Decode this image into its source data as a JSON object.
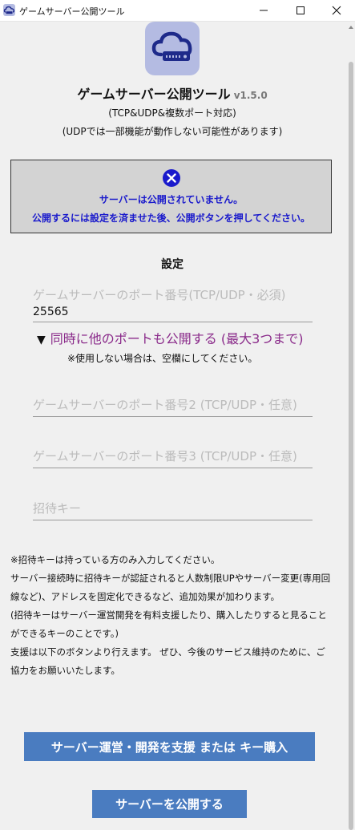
{
  "window": {
    "title": "ゲームサーバー公開ツール"
  },
  "app": {
    "name": "ゲームサーバー公開ツール",
    "version": "v1.5.0",
    "subtitle1": "(TCP&UDP&複数ポート対応)",
    "subtitle2": "(UDPでは一部機能が動作しない可能性があります)"
  },
  "status": {
    "line1": "サーバーは公開されていません。",
    "line2": "公開するには設定を済ませた後、公開ボタンを押してください。",
    "color": "#1a1acc"
  },
  "settings": {
    "heading": "設定",
    "port1": {
      "label": "ゲームサーバーのポート番号(TCP/UDP・必須)",
      "value": "25565"
    },
    "expander": {
      "arrow": "▼",
      "label": "同時に他のポートも公開する (最大3つまで)"
    },
    "note": "※使用しない場合は、空欄にしてください。",
    "port2": {
      "placeholder": "ゲームサーバーのポート番号2 (TCP/UDP・任意)"
    },
    "port3": {
      "placeholder": "ゲームサーバーのポート番号3 (TCP/UDP・任意)"
    },
    "invite": {
      "placeholder": "招待キー"
    }
  },
  "info": [
    "※招待キーは持っている方のみ入力してください。",
    "サーバー接続時に招待キーが認証されると人数制限UPやサーバー変更(専用回線など)、アドレスを固定化できるなど、追加効果が加わります。",
    "(招待キーはサーバー運営開発を有料支援したり、購入したりすると見ることができるキーのことです。)",
    "支援は以下のボタンより行えます。 ぜひ、今後のサービス維持のために、ご協力をお願いいたします。"
  ],
  "buttons": {
    "support": "サーバー運営・開発を支援 または キー購入",
    "publish": "サーバーを公開する"
  },
  "colors": {
    "accent": "#4a7cc0",
    "icon_bg": "#b4bbe2",
    "link_purple": "#8a2a8a"
  },
  "icons": {
    "app": "cloud-server-icon",
    "status": "x-circle-icon",
    "minimize": "minimize-icon",
    "maximize": "maximize-icon",
    "close": "close-icon"
  }
}
